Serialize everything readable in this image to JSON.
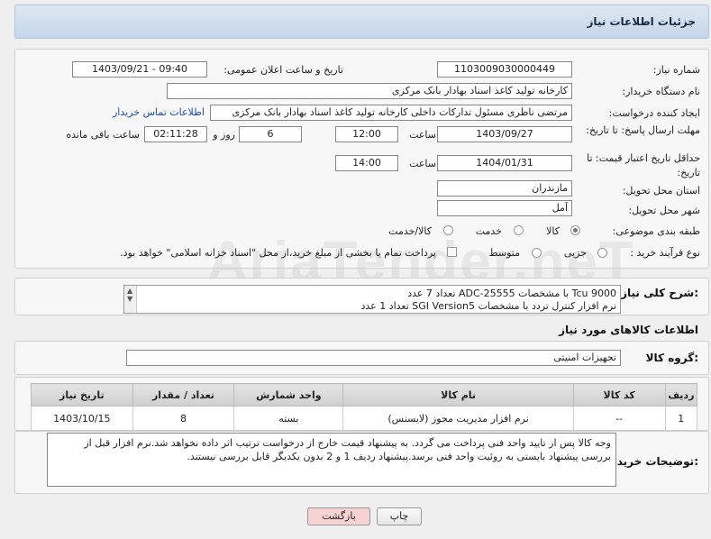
{
  "header": {
    "title": "جزئیات اطلاعات نیاز"
  },
  "labels": {
    "need_number": "شماره نیاز:",
    "announce_datetime": "تاریخ و ساعت اعلان عمومی:",
    "buyer_org": "نام دستگاه خریدار:",
    "requester": "ایجاد کننده درخواست:",
    "reply_deadline": "مهلت ارسال پاسخ: تا تاریخ:",
    "hour1": "ساعت",
    "day_and": "روز و",
    "remaining": "ساعت باقی مانده",
    "price_validity": "حداقل تاریخ اعتبار قیمت: تا تاریخ:",
    "hour2": "ساعت",
    "province": "استان محل تحویل:",
    "city": "شهر محل تحویل:",
    "category": "طبقه بندی موضوعی:",
    "process": "نوع فرآیند خرید :",
    "description": "شرح کلی نیاز:",
    "goods_info": "اطلاعات کالاهای مورد نیاز",
    "goods_group": "گروه کالا:",
    "buyer_notes": "توضیحات خریدار:"
  },
  "values": {
    "need_number": "1103009030000449",
    "announce_datetime": "1403/09/21 - 09:40",
    "buyer_org": "کارخانه تولید کاغذ اسناد بهادار بانک مرکزی",
    "requester": "مرتضی ناظری مسئول تدارکات داخلی کارخانه تولید کاغذ اسناد بهادار بانک مرکزی",
    "contact_link": "اطلاعات تماس خریدار",
    "reply_date": "1403/09/27",
    "reply_time": "12:00",
    "days": "6",
    "remaining_time": "02:11:28",
    "validity_date": "1404/01/31",
    "validity_time": "14:00",
    "province": "مازندران",
    "city": "آمل",
    "goods_group": "تجهیزات امنیتی"
  },
  "category_options": [
    {
      "label": "کالا",
      "selected": true
    },
    {
      "label": "خدمت",
      "selected": false
    },
    {
      "label": "کالا/خدمت",
      "selected": false
    }
  ],
  "process_options": [
    {
      "label": "جزیی",
      "selected": false
    },
    {
      "label": "متوسط",
      "selected": false
    }
  ],
  "payment_checkbox_label": "پرداخت تمام یا بخشی از مبلغ خرید،از محل \"اسناد خزانه اسلامی\" خواهد بود.",
  "description_lines": [
    "Tcu 9000 با مشخصات ADC-25555      تعداد 7 عدد",
    "نرم افزار کنترل تردد با مشخصات SGI Version5      تعداد 1 عدد"
  ],
  "table": {
    "headers": [
      "ردیف",
      "کد کالا",
      "نام کالا",
      "واحد شمارش",
      "تعداد / مقدار",
      "تاریخ نیاز"
    ],
    "rows": [
      [
        "1",
        "--",
        "نرم افزار مدیریت مجوز (لایسنس)",
        "بسته",
        "8",
        "1403/10/15"
      ]
    ]
  },
  "buyer_notes": "وجه کالا پس از تایید واحد فنی پرداخت می گردد. به پیشنهاد قیمت خارج از درخواست ترتیب اثر داده نخواهد شد.نرم افزار قبل از بررسی پیشنهاد بایستی به روئیت واحد فنی برسد.پیشنهاد ردیف 1 و 2 بدون یکدیگر قابل بررسی نیستند.",
  "buttons": {
    "print": "چاپ",
    "back": "بازگشت"
  },
  "watermark": "AriaTender.neT",
  "colors": {
    "accent": "#1f4ea8",
    "back_button": "#f6d2d2"
  }
}
